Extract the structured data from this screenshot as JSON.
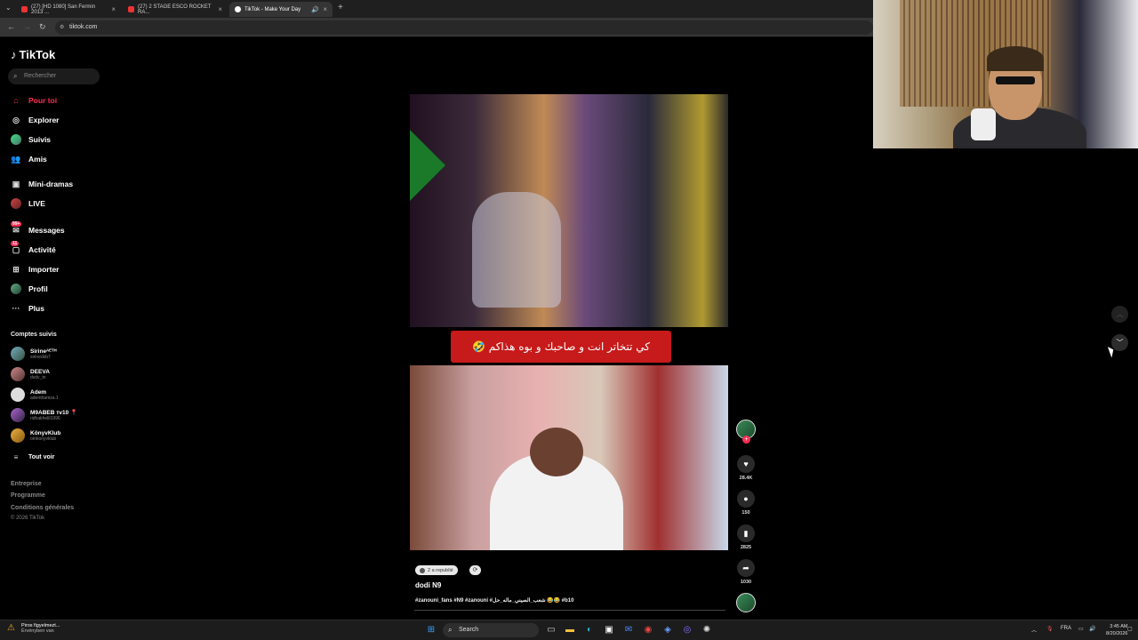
{
  "browser": {
    "tabs": [
      {
        "label": "(27) [HD 1080] San Fermin 2013 ...",
        "active": false
      },
      {
        "label": "(27) 2 STAGE ESCO ROCKET RA...",
        "active": false
      },
      {
        "label": "TikTok - Make Your Day",
        "active": true
      }
    ],
    "new_tab": "+",
    "url": "tiktok.com"
  },
  "sidebar": {
    "logo": "TikTok",
    "search_placeholder": "Rechercher",
    "nav": [
      {
        "label": "Pour toi",
        "icon": "home-icon"
      },
      {
        "label": "Explorer",
        "icon": "compass-icon"
      },
      {
        "label": "Suivis",
        "icon": "following-avatar-icon"
      },
      {
        "label": "Amis",
        "icon": "friends-icon"
      },
      {
        "label": "Mini-dramas",
        "icon": "film-icon"
      },
      {
        "label": "LIVE",
        "icon": "live-icon"
      },
      {
        "label": "Messages",
        "icon": "message-icon",
        "badge": "99+"
      },
      {
        "label": "Activité",
        "icon": "activity-icon",
        "badge": "11"
      },
      {
        "label": "Importer",
        "icon": "upload-icon"
      },
      {
        "label": "Profil",
        "icon": "profile-avatar-icon"
      },
      {
        "label": "Plus",
        "icon": "more-icon"
      }
    ],
    "followed_title": "Comptes suivis",
    "accounts": [
      {
        "name": "Sirineᴬᴱᵀᴴ",
        "handle": "sirinedxb7"
      },
      {
        "name": "DEEVA",
        "handle": "dvdv_tn"
      },
      {
        "name": "Adem",
        "handle": "ademhamza.1"
      },
      {
        "name": "M9ABEB ᴛᴠ10 📍",
        "handle": "ridhakhelil1996"
      },
      {
        "name": "KönyvKlub",
        "handle": "omkonyvklub"
      }
    ],
    "see_all": "Tout voir",
    "footer": [
      "Entreprise",
      "Programme",
      "Conditions générales"
    ],
    "copyright": "© 2026 TikTok"
  },
  "video": {
    "caption_overlay": "🤣 كي تتخاتر انت و صاحبك و بوه هذاكم",
    "repost_label": "2 a republié",
    "author": "dodi N9",
    "hashtags": "#zanouni_fans #N9 #zanouni #شعب_الصيني_ماله_حل 😂😂 #b10",
    "likes": "28.4K",
    "comments": "150",
    "saves": "2825",
    "shares": "1030"
  },
  "taskbar": {
    "notification_title": "Piros figyelmezt...",
    "notification_sub": "Érvényben van",
    "search_label": "Search",
    "lang": "FRA",
    "time": "3:45 AM",
    "date": "8/20/2026"
  }
}
